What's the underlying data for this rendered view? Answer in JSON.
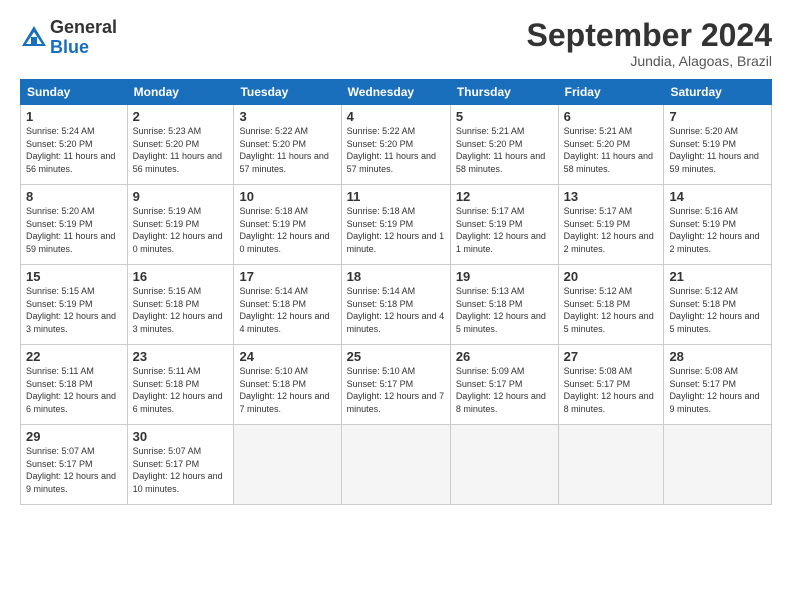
{
  "header": {
    "logo_general": "General",
    "logo_blue": "Blue",
    "month_title": "September 2024",
    "subtitle": "Jundia, Alagoas, Brazil"
  },
  "weekdays": [
    "Sunday",
    "Monday",
    "Tuesday",
    "Wednesday",
    "Thursday",
    "Friday",
    "Saturday"
  ],
  "weeks": [
    [
      {
        "day": "1",
        "info": "Sunrise: 5:24 AM\nSunset: 5:20 PM\nDaylight: 11 hours and 56 minutes."
      },
      {
        "day": "2",
        "info": "Sunrise: 5:23 AM\nSunset: 5:20 PM\nDaylight: 11 hours and 56 minutes."
      },
      {
        "day": "3",
        "info": "Sunrise: 5:22 AM\nSunset: 5:20 PM\nDaylight: 11 hours and 57 minutes."
      },
      {
        "day": "4",
        "info": "Sunrise: 5:22 AM\nSunset: 5:20 PM\nDaylight: 11 hours and 57 minutes."
      },
      {
        "day": "5",
        "info": "Sunrise: 5:21 AM\nSunset: 5:20 PM\nDaylight: 11 hours and 58 minutes."
      },
      {
        "day": "6",
        "info": "Sunrise: 5:21 AM\nSunset: 5:20 PM\nDaylight: 11 hours and 58 minutes."
      },
      {
        "day": "7",
        "info": "Sunrise: 5:20 AM\nSunset: 5:19 PM\nDaylight: 11 hours and 59 minutes."
      }
    ],
    [
      {
        "day": "8",
        "info": "Sunrise: 5:20 AM\nSunset: 5:19 PM\nDaylight: 11 hours and 59 minutes."
      },
      {
        "day": "9",
        "info": "Sunrise: 5:19 AM\nSunset: 5:19 PM\nDaylight: 12 hours and 0 minutes."
      },
      {
        "day": "10",
        "info": "Sunrise: 5:18 AM\nSunset: 5:19 PM\nDaylight: 12 hours and 0 minutes."
      },
      {
        "day": "11",
        "info": "Sunrise: 5:18 AM\nSunset: 5:19 PM\nDaylight: 12 hours and 1 minute."
      },
      {
        "day": "12",
        "info": "Sunrise: 5:17 AM\nSunset: 5:19 PM\nDaylight: 12 hours and 1 minute."
      },
      {
        "day": "13",
        "info": "Sunrise: 5:17 AM\nSunset: 5:19 PM\nDaylight: 12 hours and 2 minutes."
      },
      {
        "day": "14",
        "info": "Sunrise: 5:16 AM\nSunset: 5:19 PM\nDaylight: 12 hours and 2 minutes."
      }
    ],
    [
      {
        "day": "15",
        "info": "Sunrise: 5:15 AM\nSunset: 5:19 PM\nDaylight: 12 hours and 3 minutes."
      },
      {
        "day": "16",
        "info": "Sunrise: 5:15 AM\nSunset: 5:18 PM\nDaylight: 12 hours and 3 minutes."
      },
      {
        "day": "17",
        "info": "Sunrise: 5:14 AM\nSunset: 5:18 PM\nDaylight: 12 hours and 4 minutes."
      },
      {
        "day": "18",
        "info": "Sunrise: 5:14 AM\nSunset: 5:18 PM\nDaylight: 12 hours and 4 minutes."
      },
      {
        "day": "19",
        "info": "Sunrise: 5:13 AM\nSunset: 5:18 PM\nDaylight: 12 hours and 5 minutes."
      },
      {
        "day": "20",
        "info": "Sunrise: 5:12 AM\nSunset: 5:18 PM\nDaylight: 12 hours and 5 minutes."
      },
      {
        "day": "21",
        "info": "Sunrise: 5:12 AM\nSunset: 5:18 PM\nDaylight: 12 hours and 5 minutes."
      }
    ],
    [
      {
        "day": "22",
        "info": "Sunrise: 5:11 AM\nSunset: 5:18 PM\nDaylight: 12 hours and 6 minutes."
      },
      {
        "day": "23",
        "info": "Sunrise: 5:11 AM\nSunset: 5:18 PM\nDaylight: 12 hours and 6 minutes."
      },
      {
        "day": "24",
        "info": "Sunrise: 5:10 AM\nSunset: 5:18 PM\nDaylight: 12 hours and 7 minutes."
      },
      {
        "day": "25",
        "info": "Sunrise: 5:10 AM\nSunset: 5:17 PM\nDaylight: 12 hours and 7 minutes."
      },
      {
        "day": "26",
        "info": "Sunrise: 5:09 AM\nSunset: 5:17 PM\nDaylight: 12 hours and 8 minutes."
      },
      {
        "day": "27",
        "info": "Sunrise: 5:08 AM\nSunset: 5:17 PM\nDaylight: 12 hours and 8 minutes."
      },
      {
        "day": "28",
        "info": "Sunrise: 5:08 AM\nSunset: 5:17 PM\nDaylight: 12 hours and 9 minutes."
      }
    ],
    [
      {
        "day": "29",
        "info": "Sunrise: 5:07 AM\nSunset: 5:17 PM\nDaylight: 12 hours and 9 minutes."
      },
      {
        "day": "30",
        "info": "Sunrise: 5:07 AM\nSunset: 5:17 PM\nDaylight: 12 hours and 10 minutes."
      },
      {
        "day": "",
        "info": ""
      },
      {
        "day": "",
        "info": ""
      },
      {
        "day": "",
        "info": ""
      },
      {
        "day": "",
        "info": ""
      },
      {
        "day": "",
        "info": ""
      }
    ]
  ]
}
